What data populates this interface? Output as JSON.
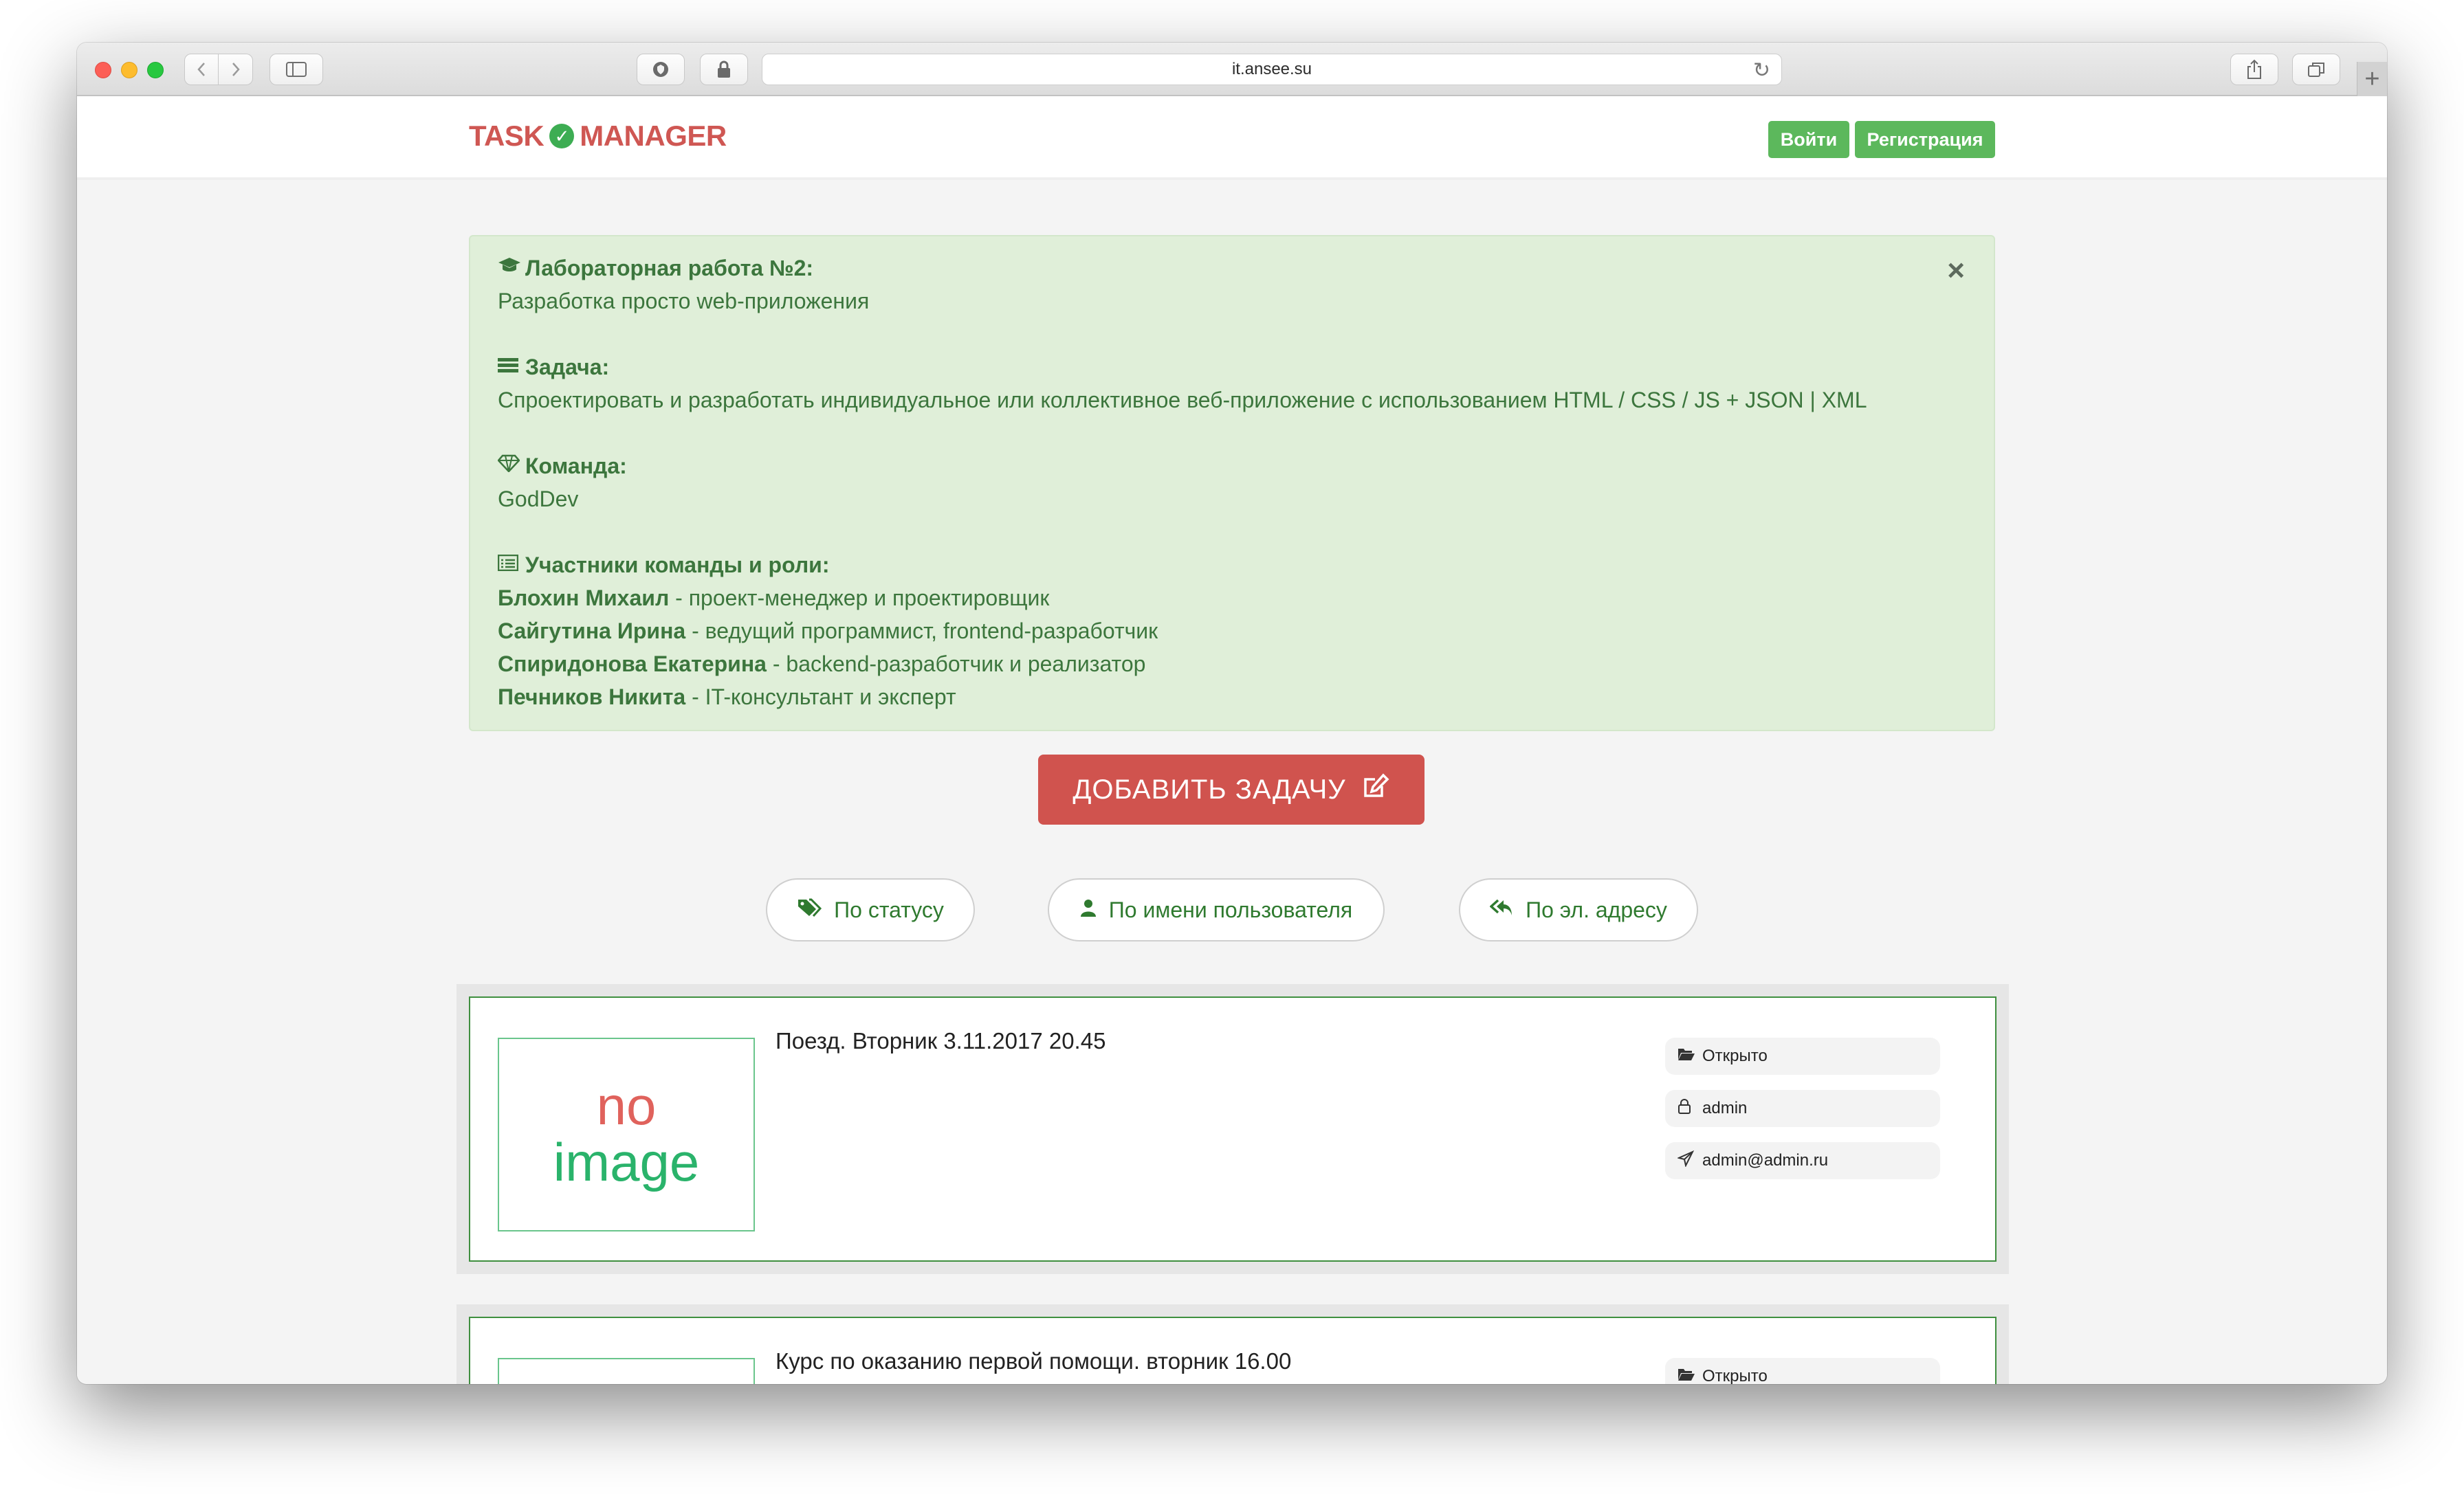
{
  "browser": {
    "url": "it.ansee.su",
    "add_tab": "+"
  },
  "brand": {
    "part1": "TASK",
    "part2": "MANAGER"
  },
  "nav": {
    "login": "Войти",
    "register": "Регистрация"
  },
  "alert": {
    "close": "×",
    "lab_title": "Лабораторная работа №2:",
    "lab_text": "Разработка просто web-приложения",
    "task_title": "Задача:",
    "task_text": "Спроектировать и разработать индивидуальное или коллективное веб-приложение с использованием HTML / CSS / JS + JSON | XML",
    "team_title": "Команда:",
    "team_text": "GodDev",
    "members_title": "Участники команды и роли:",
    "members": [
      {
        "name": "Блохин Михаил",
        "role": " - проект-менеджер и проектировщик"
      },
      {
        "name": "Сайгутина Ирина",
        "role": " - ведущий программист, frontend-разработчик"
      },
      {
        "name": "Спиридонова Екатерина",
        "role": " - backend-разработчик и реализатор"
      },
      {
        "name": "Печников Никита",
        "role": " - IT-консультант и эксперт"
      }
    ]
  },
  "add_task": "ДОБАВИТЬ ЗАДАЧУ",
  "filters": {
    "status": "По статусу",
    "user": "По имени пользователя",
    "email": "По эл. адресу"
  },
  "tasks": [
    {
      "title": "Поезд. Вторник 3.11.2017 20.45",
      "image_no": "no",
      "image_img": "image",
      "status": "Открыто",
      "user": "admin",
      "email": "admin@admin.ru"
    },
    {
      "title": "Курс по оказанию первой помощи. вторник 16.00",
      "status": "Открыто"
    }
  ],
  "colors": {
    "brand": "#cf5753",
    "success": "#5cb85c",
    "alert_bg": "#e0efd9",
    "alert_text": "#3c763d",
    "danger": "#d0534e",
    "card_border": "#3f8f3f"
  }
}
